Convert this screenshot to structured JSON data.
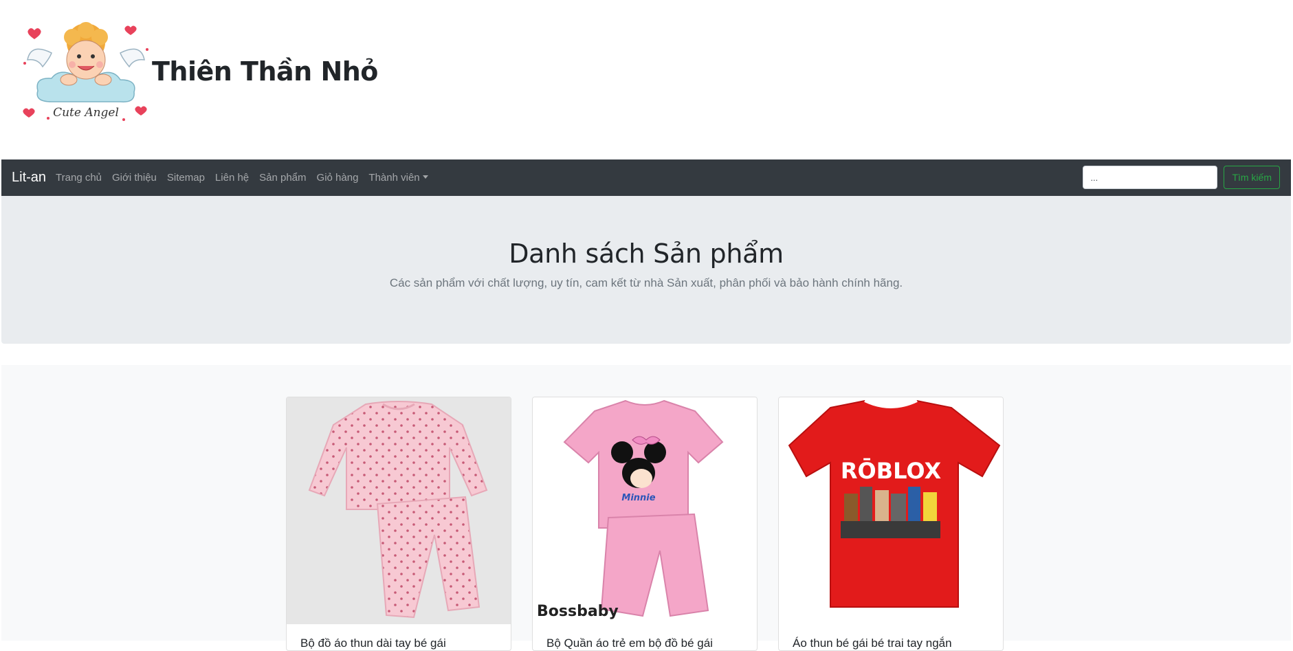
{
  "header": {
    "title": "Thiên Thần Nhỏ",
    "logo_text": "Cute Angel"
  },
  "navbar": {
    "brand": "Lit-an",
    "links": [
      "Trang chủ",
      "Giới thiệu",
      "Sitemap",
      "Liên hệ",
      "Sản phẩm",
      "Giỏ hàng"
    ],
    "dropdown_label": "Thành viên",
    "search": {
      "value": "...",
      "placeholder": "Tìm kiếm",
      "button_label": "Tìm kiếm"
    }
  },
  "jumbotron": {
    "title": "Danh sách Sản phẩm",
    "lead": "Các sản phẩm với chất lượng, uy tín, cam kết từ nhà Sản xuất, phân phối và bảo hành chính hãng."
  },
  "products": [
    {
      "title": "Bộ đồ áo thun dài tay bé gái",
      "image": "pink-polka-dot-pajamas"
    },
    {
      "title": "Bộ Quần áo trẻ em bộ đồ bé gái",
      "image": "pink-minnie-outfit",
      "image_caption": "Bossbaby"
    },
    {
      "title": "Áo thun bé gái bé trai tay ngắn",
      "image": "red-roblox-tshirt",
      "image_caption": "RŌBLOX"
    }
  ],
  "colors": {
    "navbar_bg": "#343a40",
    "jumbotron_bg": "#e9ecef",
    "products_bg": "#f8f9fa",
    "success": "#28a745"
  }
}
